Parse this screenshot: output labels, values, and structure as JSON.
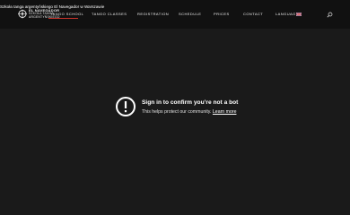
{
  "overlay_title": "Szkoła tanga argentyńskiego El Navegador w Warszawie",
  "brand": {
    "line1": "EL NAVEGADOR",
    "line2": "SZKOŁA TANGA",
    "line3": "ARGENTYŃSKIEGO"
  },
  "nav": {
    "tango_school": "TANGO SCHOOL",
    "tango_classes": "TANGO CLASSES",
    "registration": "REGISTRATION",
    "schedule": "SCHEDULE",
    "prices": "PRICES",
    "contact": "CONTACT",
    "language": "LANGUAGE"
  },
  "bot_check": {
    "title": "Sign in to confirm you’re not a bot",
    "text": "This helps protect our community.",
    "link": "Learn more"
  },
  "icons": {
    "logo": "ship-wheel-logo-icon",
    "language_flag": "uk-flag-icon",
    "search": "search-icon",
    "alert": "alert-circle-icon"
  },
  "colors": {
    "page_background": "#1a1a1a",
    "header_background": "#111111",
    "accent": "#c9332b",
    "text": "#ffffff"
  }
}
